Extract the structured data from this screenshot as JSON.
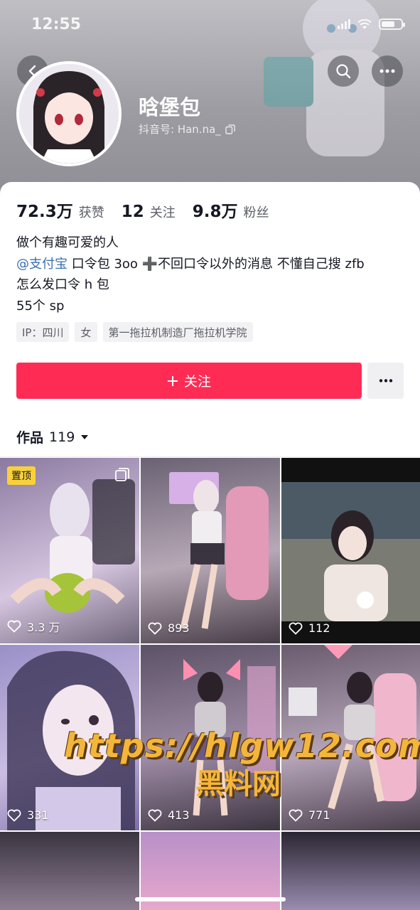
{
  "status_bar": {
    "time": "12:55"
  },
  "profile": {
    "nickname": "晗堡包",
    "douyin_id": "抖音号: Han.na_"
  },
  "stats": [
    {
      "num": "72.3万",
      "label": "获赞"
    },
    {
      "num": "12",
      "label": "关注"
    },
    {
      "num": "9.8万",
      "label": "粉丝"
    }
  ],
  "bio": {
    "line1": "做个有趣可爱的人",
    "mention": "@支付宝",
    "line2_rest": " 口令包 3oo ➕不回口令以外的消息 不懂自己搜 zfb",
    "line3": "怎么发口令 h 包",
    "line4": "55个 sp"
  },
  "tags": [
    "IP：四川",
    "女",
    "第一拖拉机制造厂拖拉机学院"
  ],
  "actions": {
    "follow_label": "关注"
  },
  "works": {
    "label": "作品",
    "count": "119"
  },
  "videos": [
    {
      "likes": "3.3 万",
      "pinned": "置顶"
    },
    {
      "likes": "893"
    },
    {
      "likes": "112"
    },
    {
      "likes": "331"
    },
    {
      "likes": "413"
    },
    {
      "likes": "771"
    }
  ],
  "watermark": {
    "url": "https://hlgw12.com",
    "name": "黑料网"
  },
  "colors": {
    "accent": "#fe2c55",
    "mention": "#3a6fb6",
    "pin": "#f8d13a"
  }
}
